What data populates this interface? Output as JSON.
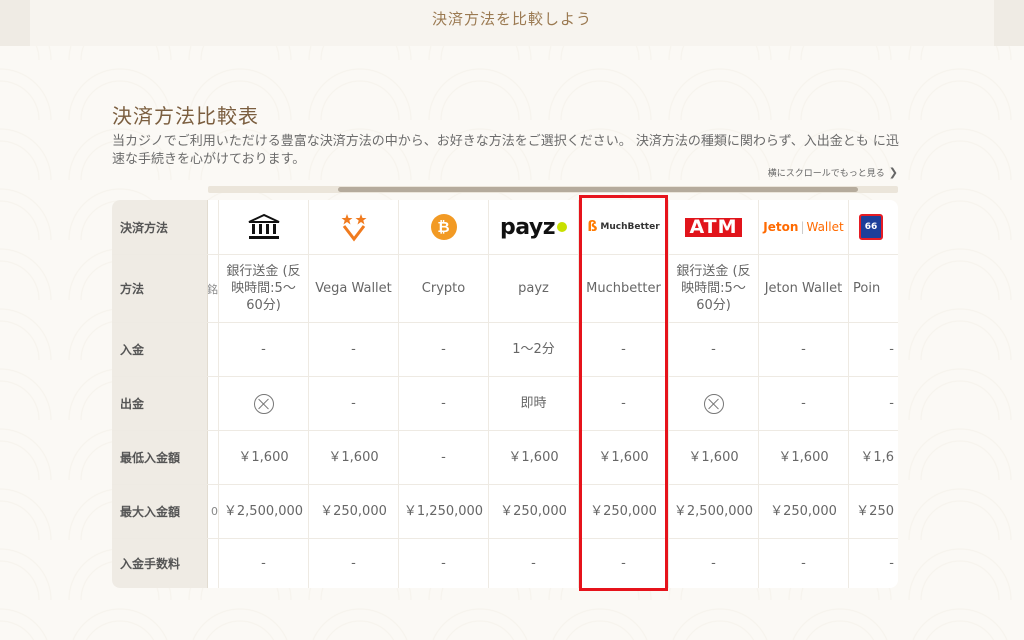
{
  "top_title": "決済方法を比較しよう",
  "section": {
    "title": "決済方法比較表",
    "description": "当カジノでご利用いただける豊富な決済方法の中から、お好きな方法をご選択ください。 決済方法の種類に関わらず、入出金とも に迅速な手続きを心がけております。",
    "scroll_hint": "横にスクロールでもっと見る"
  },
  "row_headers": {
    "method_logo": "決済方法",
    "method": "方法",
    "deposit": "入金",
    "withdrawal": "出金",
    "min_deposit": "最低入金額",
    "max_deposit": "最大入金額",
    "deposit_fee": "入金手数料"
  },
  "partial_column": {
    "method": "銘",
    "max_deposit": "0"
  },
  "columns": [
    {
      "logo": "bank-icon",
      "method": "銀行送金 (反映時間:5〜60分)",
      "deposit": "-",
      "withdrawal": "⊗",
      "withdrawal_icon": "x-circle-icon",
      "min_deposit": "￥1,600",
      "max_deposit": "￥2,500,000",
      "deposit_fee": "-"
    },
    {
      "logo": "vega-wallet-logo",
      "method": "Vega Wallet",
      "deposit": "-",
      "withdrawal": "-",
      "min_deposit": "￥1,600",
      "max_deposit": "￥250,000",
      "deposit_fee": "-"
    },
    {
      "logo": "bitcoin-logo",
      "logo_text": "₿",
      "method": "Crypto",
      "deposit": "-",
      "withdrawal": "-",
      "min_deposit": "-",
      "max_deposit": "￥1,250,000",
      "deposit_fee": "-"
    },
    {
      "logo": "payz-logo",
      "logo_text": "payz",
      "method": "payz",
      "deposit": "1〜2分",
      "withdrawal": "即時",
      "min_deposit": "￥1,600",
      "max_deposit": "￥250,000",
      "deposit_fee": "-"
    },
    {
      "logo": "muchbetter-logo",
      "logo_text": "MuchBetter",
      "method": "Muchbetter",
      "deposit": "-",
      "withdrawal": "-",
      "min_deposit": "￥1,600",
      "max_deposit": "￥250,000",
      "deposit_fee": "-"
    },
    {
      "logo": "atm-logo",
      "logo_text": "ATM",
      "method": "銀行送金 (反映時間:5〜60分)",
      "deposit": "-",
      "withdrawal": "⊗",
      "withdrawal_icon": "x-circle-icon",
      "min_deposit": "￥1,600",
      "max_deposit": "￥2,500,000",
      "deposit_fee": "-"
    },
    {
      "logo": "jeton-wallet-logo",
      "logo_text_a": "Jeton",
      "logo_text_b": "Wallet",
      "method": "Jeton Wallet",
      "deposit": "-",
      "withdrawal": "-",
      "min_deposit": "￥1,600",
      "max_deposit": "￥250,000",
      "deposit_fee": "-"
    },
    {
      "logo": "point66-logo",
      "logo_text": "66",
      "method": "Poin",
      "deposit": "-",
      "withdrawal": "-",
      "min_deposit": "￥1,6",
      "max_deposit": "￥250",
      "deposit_fee": "-"
    }
  ],
  "highlight": {
    "column": "Muchbetter",
    "color": "#e6131b"
  }
}
